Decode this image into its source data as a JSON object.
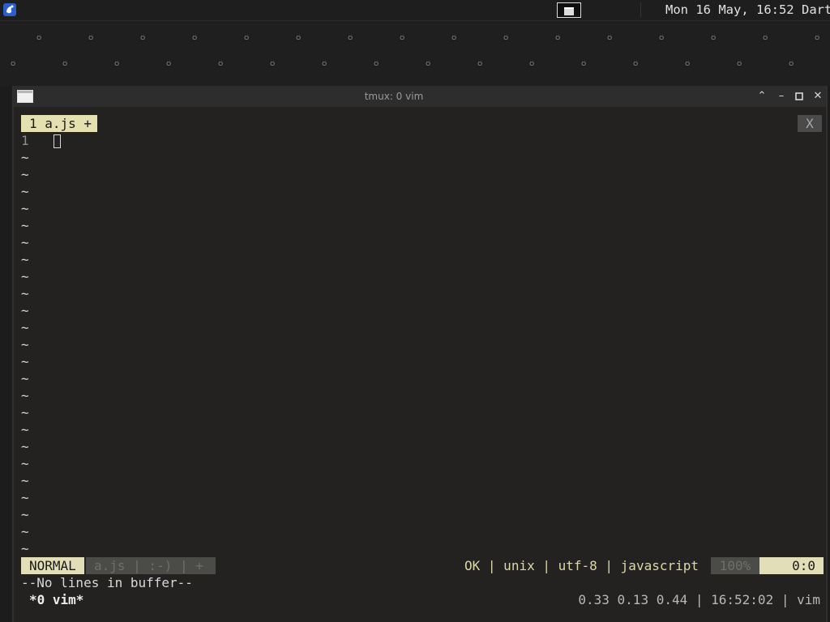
{
  "panel": {
    "menu_icon": "distro-logo-icon",
    "clock": "Mon 16 May, 16:52",
    "user": "Dartz"
  },
  "window": {
    "title": "tmux: 0 vim",
    "buttons": [
      "shade-icon",
      "minimize-icon",
      "maximize-icon",
      "close-icon"
    ]
  },
  "vim": {
    "tab_label": "1 a.js +",
    "tab_close": "X",
    "line_number": "1",
    "tilde": "~",
    "status": {
      "mode": "NORMAL",
      "left_segment": "a.js | :-) | +",
      "right_info": "OK | unix | utf-8 | javascript",
      "percent": "100%",
      "position": "0:0"
    },
    "message": "--No lines in buffer--"
  },
  "tmux": {
    "window_list": "*0 vim*",
    "right_status": "0.33 0.13 0.44 | 16:52:02 | vim"
  },
  "colors": {
    "background": "#242220",
    "accent": "#e2dfb8",
    "inactive_segment": "#4b4b48",
    "status_text": "#dcd7a8"
  }
}
